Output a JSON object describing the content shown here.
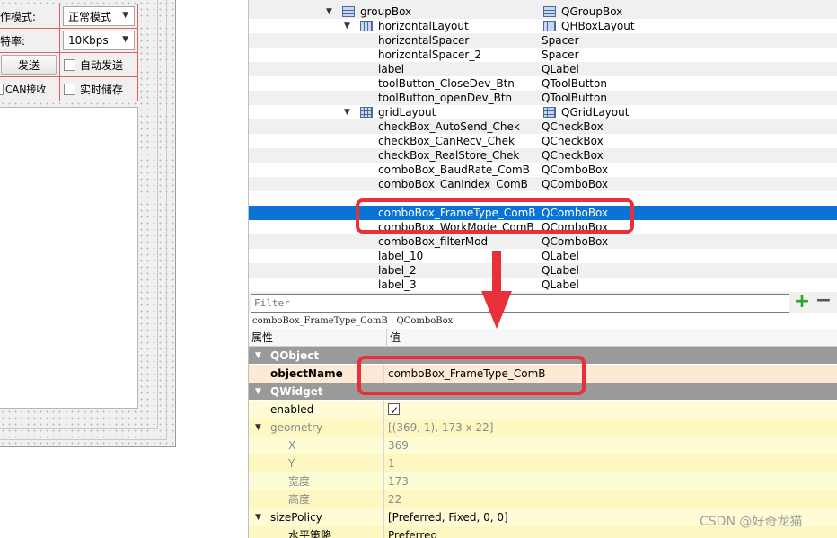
{
  "designer": {
    "rows": [
      {
        "label": "作模式:",
        "combo": "正常模式"
      },
      {
        "label": "特率:",
        "combo": "10Kbps"
      }
    ],
    "send_button": "发送",
    "auto_send": "自动发送",
    "can_recv": "CAN接收",
    "realtime_store": "实时储存"
  },
  "tree": {
    "rows": [
      {
        "name": "groupBox",
        "class": "QGroupBox",
        "indent": 1,
        "expand": "▼",
        "icon": "vbox"
      },
      {
        "name": "horizontalLayout",
        "class": "QHBoxLayout",
        "indent": 2,
        "expand": "▼",
        "icon": "hbox"
      },
      {
        "name": "horizontalSpacer",
        "class": "Spacer",
        "indent": 3
      },
      {
        "name": "horizontalSpacer_2",
        "class": "Spacer",
        "indent": 3
      },
      {
        "name": "label",
        "class": "QLabel",
        "indent": 3
      },
      {
        "name": "toolButton_CloseDev_Btn",
        "class": "QToolButton",
        "indent": 3
      },
      {
        "name": "toolButton_openDev_Btn",
        "class": "QToolButton",
        "indent": 3
      },
      {
        "name": "gridLayout",
        "class": "QGridLayout",
        "indent": 2,
        "expand": "▼",
        "icon": "grid"
      },
      {
        "name": "checkBox_AutoSend_Chek",
        "class": "QCheckBox",
        "indent": 3
      },
      {
        "name": "checkBox_CanRecv_Chek",
        "class": "QCheckBox",
        "indent": 3
      },
      {
        "name": "checkBox_RealStore_Chek",
        "class": "QCheckBox",
        "indent": 3
      },
      {
        "name": "comboBox_BaudRate_ComB",
        "class": "QComboBox",
        "indent": 3
      },
      {
        "name": "comboBox_CanIndex_ComB",
        "class": "QComboBox",
        "indent": 3
      },
      {
        "name": "",
        "class": "",
        "indent": 3
      },
      {
        "name": "comboBox_FrameType_ComB",
        "class": "QComboBox",
        "indent": 3,
        "selected": true
      },
      {
        "name": "comboBox_WorkMode_ComB",
        "class": "QComboBox",
        "indent": 3
      },
      {
        "name": "comboBox_filterMod",
        "class": "QComboBox",
        "indent": 3
      },
      {
        "name": "label_10",
        "class": "QLabel",
        "indent": 3
      },
      {
        "name": "label_2",
        "class": "QLabel",
        "indent": 3
      },
      {
        "name": "label_3",
        "class": "QLabel",
        "indent": 3
      }
    ]
  },
  "filter": {
    "placeholder": "Filter"
  },
  "object_info": "comboBox_FrameType_ComB : QComboBox",
  "properties": {
    "header": {
      "property": "属性",
      "value": "值"
    },
    "rows": [
      {
        "kind": "group",
        "name": "QObject"
      },
      {
        "kind": "orange",
        "name": "objectName",
        "value": "comboBox_FrameType_ComB",
        "bold": true
      },
      {
        "kind": "group",
        "name": "QWidget"
      },
      {
        "kind": "yellow",
        "name": "enabled",
        "value": "",
        "check": true
      },
      {
        "kind": "yellow2",
        "name": "geometry",
        "value": "[(369, 1), 173 x 22]",
        "expand": "▼",
        "sub": true
      },
      {
        "kind": "yellow",
        "name": "X",
        "value": "369",
        "indent": true,
        "sub": true
      },
      {
        "kind": "yellow2",
        "name": "Y",
        "value": "1",
        "indent": true,
        "sub": true
      },
      {
        "kind": "yellow",
        "name": "宽度",
        "value": "173",
        "indent": true,
        "sub": true
      },
      {
        "kind": "yellow2",
        "name": "高度",
        "value": "22",
        "indent": true,
        "sub": true
      },
      {
        "kind": "yellow",
        "name": "sizePolicy",
        "value": "[Preferred, Fixed, 0, 0]",
        "expand": "▼"
      },
      {
        "kind": "yellow2",
        "name": "水平策略",
        "value": "Preferred",
        "indent": true
      }
    ]
  },
  "watermark": "CSDN @好奇龙猫",
  "colors": {
    "accent_red": "#e8303a",
    "selection": "#0a74d6"
  }
}
